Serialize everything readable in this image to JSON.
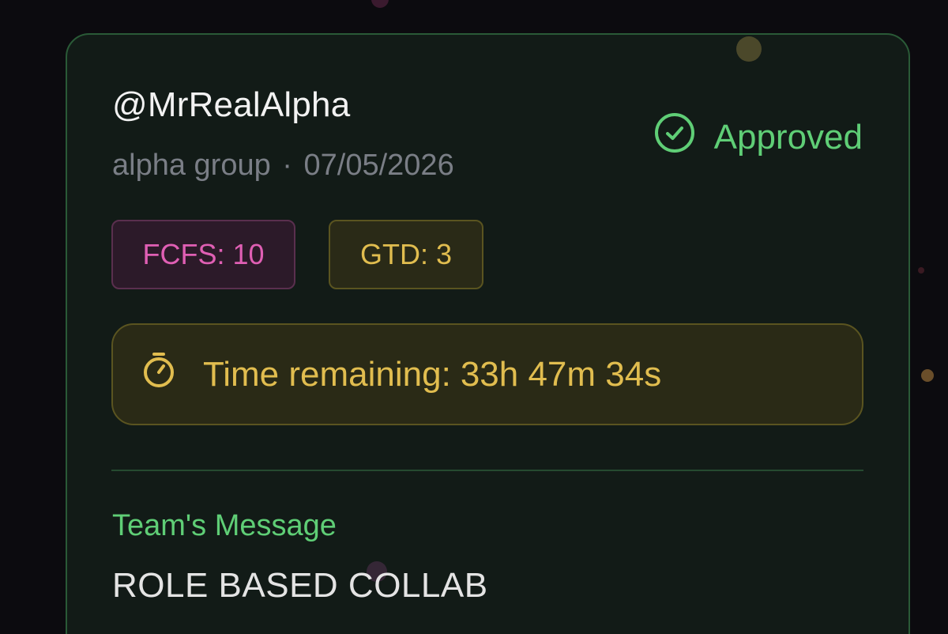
{
  "submission": {
    "handle": "@MrRealAlpha",
    "group": "alpha group",
    "separator": "·",
    "date": "07/05/2026",
    "status": "Approved",
    "status_icon": "check-circle-icon",
    "status_color": "#5fce76"
  },
  "allocations": {
    "fcfs_label": "FCFS: 10",
    "gtd_label": "GTD: 3"
  },
  "timer": {
    "icon": "stopwatch-icon",
    "label": "Time remaining:",
    "value": "33h 47m 34s",
    "color": "#e1bd4f"
  },
  "message": {
    "title": "Team's Message",
    "body": "ROLE BASED COLLAB"
  },
  "colors": {
    "background": "#0c0b0f",
    "card": "#121b17",
    "card_border": "#2a5a37",
    "fcfs": "#e05fb4",
    "gtd": "#e1bd4f"
  }
}
